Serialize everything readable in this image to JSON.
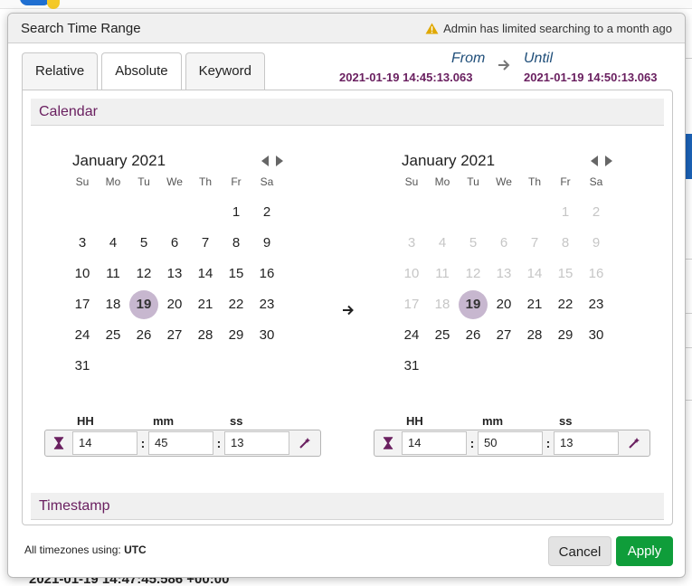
{
  "background": {
    "bottom_text": "2021-01-19 14:47:45.586 +00:00"
  },
  "modal": {
    "title": "Search Time Range",
    "warning": "Admin has limited searching to a month ago",
    "tabs": [
      {
        "label": "Relative",
        "active": false
      },
      {
        "label": "Absolute",
        "active": true
      },
      {
        "label": "Keyword",
        "active": false
      }
    ],
    "range": {
      "from_label": "From",
      "from_value": "2021-01-19 14:45:13.063",
      "until_label": "Until",
      "until_value": "2021-01-19 14:50:13.063"
    },
    "sections": {
      "calendar": "Calendar",
      "timestamp": "Timestamp"
    },
    "calendars": [
      {
        "month": "January 2021",
        "selected_day": 19,
        "hh_label": "HH",
        "mm_label": "mm",
        "ss_label": "ss",
        "hh": "14",
        "mm": "45",
        "ss": "13"
      },
      {
        "month": "January 2021",
        "selected_day": 19,
        "hh_label": "HH",
        "mm_label": "mm",
        "ss_label": "ss",
        "hh": "14",
        "mm": "50",
        "ss": "13"
      }
    ],
    "weekdays": [
      "Su",
      "Mo",
      "Tu",
      "We",
      "Th",
      "Fr",
      "Sa"
    ],
    "footer": {
      "tz_prefix": "All timezones using: ",
      "tz_value": "UTC",
      "cancel": "Cancel",
      "apply": "Apply"
    },
    "colors": {
      "accent_purple": "#6a2060",
      "apply_green": "#0f9d3a",
      "selected_circle": "#c7b7cf",
      "label_blue": "#1f4e79"
    },
    "icons": {
      "warning": "warning-icon",
      "hourglass": "hourglass-icon",
      "magic_wand": "magic-wand-icon",
      "prev": "chevron-left-icon",
      "next": "chevron-right-icon",
      "arrow": "arrow-right-icon"
    }
  }
}
